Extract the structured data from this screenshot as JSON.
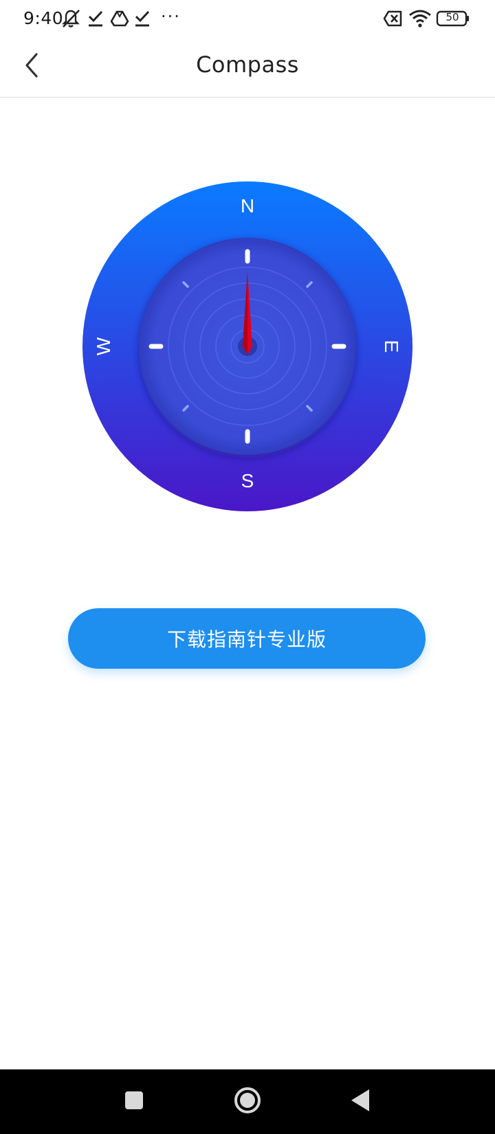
{
  "status_bar": {
    "time": "9:40",
    "overflow_indicator": "···",
    "battery_level": "50",
    "icons": [
      "notifications-off-icon",
      "check-download-icon",
      "drive-icon",
      "check-download-icon",
      "sim-off-icon",
      "wifi-icon",
      "battery-icon"
    ]
  },
  "header": {
    "title": "Compass",
    "back_icon": "chevron-left-icon"
  },
  "compass": {
    "north_label": "N",
    "south_label": "S",
    "east_label": "E",
    "west_label": "W",
    "heading_deg": 0,
    "colors": {
      "outer_top": "#0a7bff",
      "outer_bottom": "#4a17c8",
      "inner": "#3a4fd8",
      "needle": "#e0001f"
    }
  },
  "download_button": {
    "label": "下载指南针专业版",
    "color": "#1e8eef"
  },
  "nav_bar": {
    "icons": [
      "recents-square-icon",
      "home-circle-icon",
      "back-triangle-icon"
    ]
  }
}
